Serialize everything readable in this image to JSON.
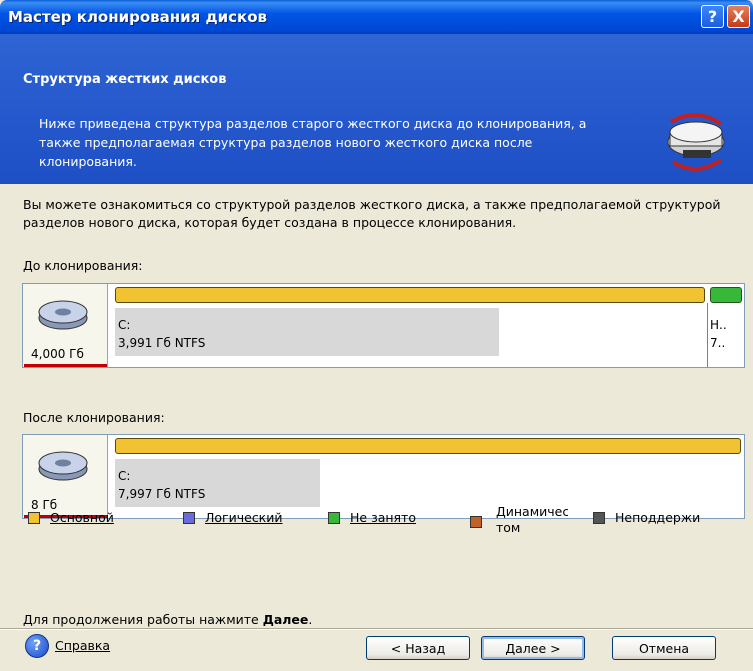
{
  "window": {
    "title": "Мастер клонирования дисков",
    "help_button": "?",
    "close_button": "X"
  },
  "header": {
    "title": "Структура жестких дисков",
    "description": "Ниже приведена структура разделов старого жесткого диска до клонирования, а также предполагаемая структура разделов нового жесткого диска после клонирования."
  },
  "body": {
    "description": "Вы можете ознакомиться со структурой разделов жесткого диска, а также предполагаемой структурой разделов нового диска, которая будет создана в процессе клонирования.",
    "before_label": "До клонирования:",
    "after_label": "После клонирования:"
  },
  "before_disk": {
    "size": "4,000 Гб",
    "partitions": [
      {
        "letter": "C:",
        "info": "3,991 Гб  NTFS",
        "type": "primary",
        "used_fraction": 0.66
      },
      {
        "letter": "Н..",
        "info": "7..",
        "type": "unallocated"
      }
    ]
  },
  "after_disk": {
    "size": "8 Гб",
    "partitions": [
      {
        "letter": "C:",
        "info": "7,997 Гб  NTFS",
        "type": "primary",
        "used_fraction": 0.33
      }
    ]
  },
  "legend": [
    {
      "label": "Основной",
      "color": "#F1C232"
    },
    {
      "label": "Логический",
      "color": "#6A6AD8"
    },
    {
      "label": "Не занято",
      "color": "#38B838"
    },
    {
      "label": "Динамический том",
      "line1": "Динамически",
      "line2": "том",
      "color": "#C0622A"
    },
    {
      "label": "Неподдержи",
      "color": "#555555"
    }
  ],
  "footer": {
    "hint_prefix": "Для продолжения работы нажмите ",
    "hint_bold": "Далее",
    "hint_suffix": "."
  },
  "buttons": {
    "help": "Справка",
    "back": "< Назад",
    "next": "Далее >",
    "cancel": "Отмена"
  }
}
